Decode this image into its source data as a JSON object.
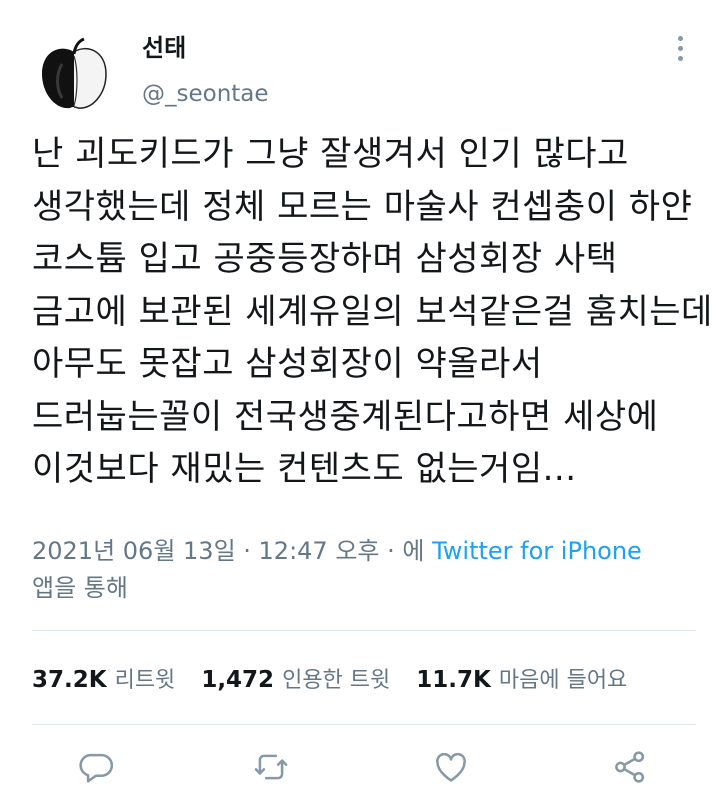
{
  "user": {
    "display_name": "선태",
    "handle": "@_seontae",
    "avatar_icon": "apple-icon"
  },
  "tweet": {
    "lines": [
      "난 괴도키드가 그냥 잘생겨서 인기 많다고",
      "생각했는데 정체 모르는 마술사 컨셉충이 하얀",
      "코스튬 입고 공중등장하며 삼성회장 사택",
      "금고에 보관된 세계유일의 보석같은걸 훔치는데",
      "아무도 못잡고 삼성회장이 약올라서",
      "드러눕는꼴이 전국생중계된다고하면 세상에",
      "이것보다 재밌는 컨텐츠도 없는거임..."
    ]
  },
  "meta": {
    "timestamp": "2021년 06월 13일 · 12:47 오후 · ",
    "via_prefix": "에 ",
    "source": "Twitter for iPhone",
    "via_suffix": "앱을 통해"
  },
  "stats": {
    "retweets": "37.2K",
    "retweets_label": "리트윗",
    "quotes": "1,472",
    "quotes_label": "인용한 트윗",
    "likes": "11.7K",
    "likes_label": "마음에 들어요"
  },
  "colors": {
    "link": "#1da1f2",
    "secondary_text": "#657786",
    "icon": "#8899a6"
  },
  "icons": {
    "more": "more-vertical-icon",
    "reply": "reply-icon",
    "retweet": "retweet-icon",
    "like": "heart-icon",
    "share": "share-icon"
  }
}
